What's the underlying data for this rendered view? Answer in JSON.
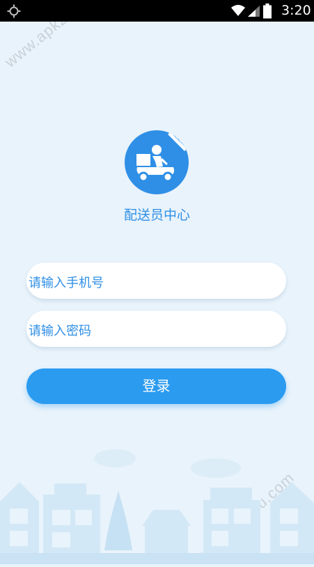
{
  "status_bar": {
    "time": "3:20",
    "icons": [
      "location-icon",
      "wifi-icon",
      "signal-icon",
      "battery-icon"
    ]
  },
  "watermark": {
    "text": "www.apkzu.com"
  },
  "logo": {
    "icon": "delivery-scooter-icon",
    "badge_text": "配送员"
  },
  "title": "配送员中心",
  "form": {
    "phone_placeholder": "请输入手机号",
    "password_placeholder": "请输入密码",
    "login_label": "登录"
  },
  "colors": {
    "accent": "#2f8fe6",
    "button": "#2b9bf0",
    "background": "#e9f3fb",
    "city_silhouette": "#cfe6f6"
  }
}
